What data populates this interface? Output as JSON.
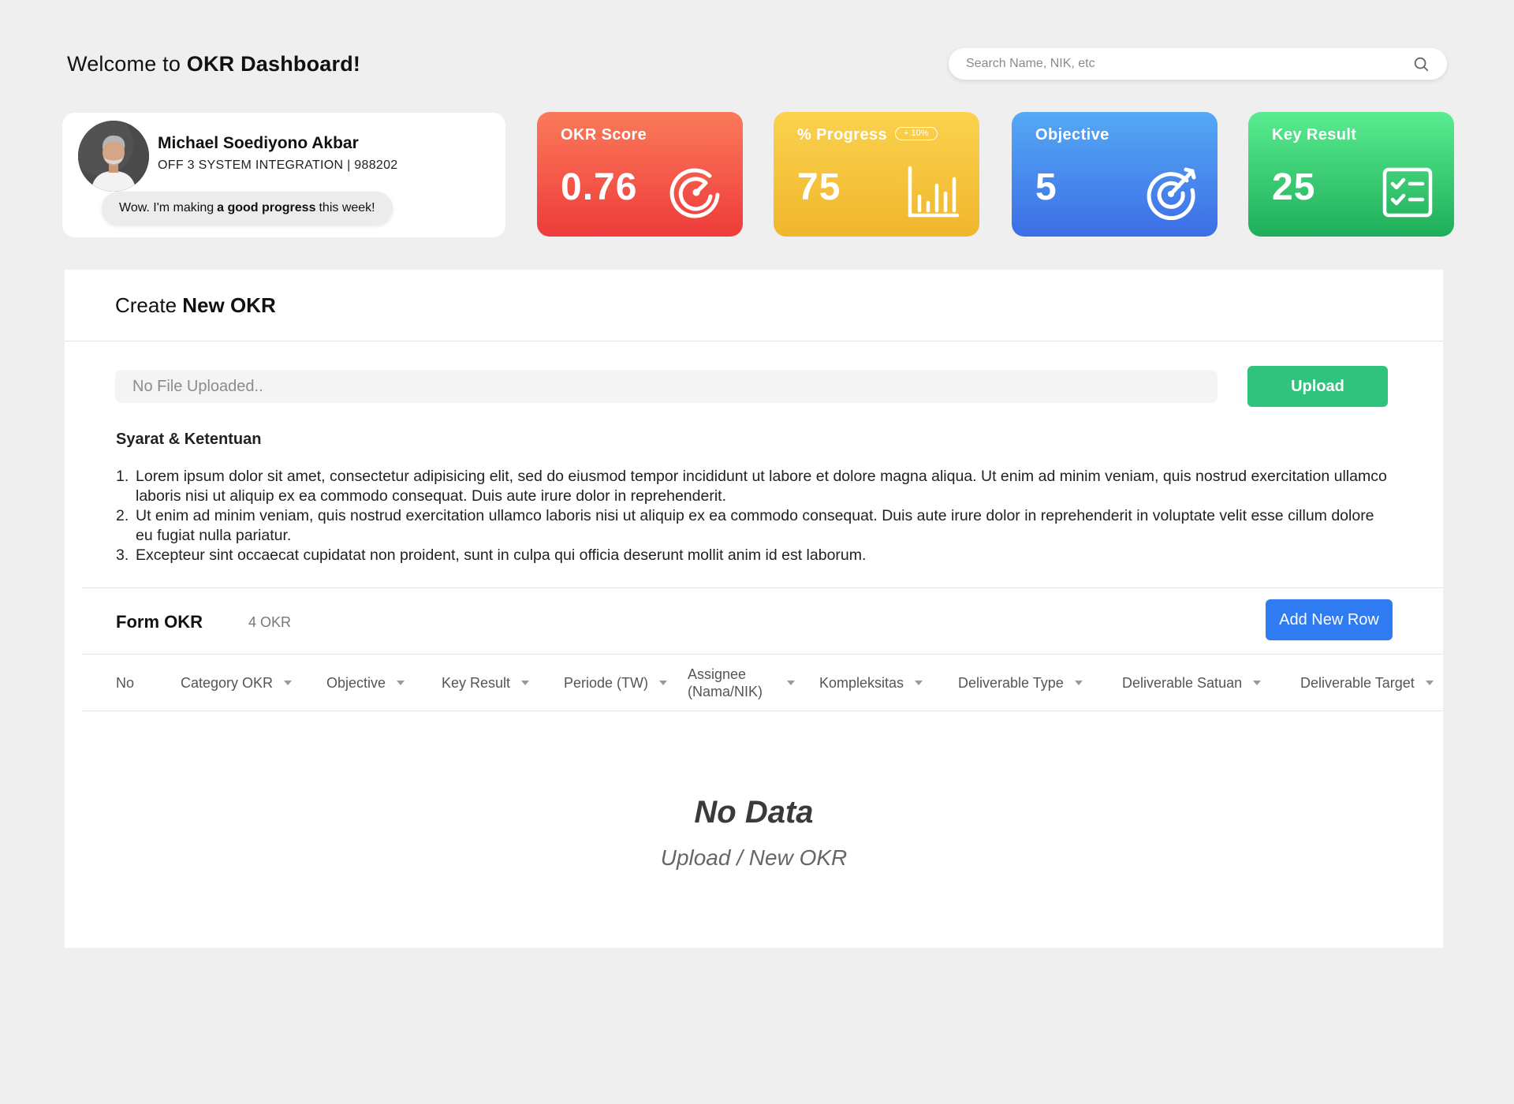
{
  "header": {
    "welcome_prefix": "Welcome to ",
    "welcome_bold": "OKR Dashboard!",
    "search_placeholder": "Search Name, NIK, etc"
  },
  "profile": {
    "name": "Michael Soediyono Akbar",
    "dept": "OFF 3 SYSTEM INTEGRATION | 988202",
    "bubble_prefix": "Wow. I'm making",
    "bubble_bold": "a good progress",
    "bubble_suffix": "this week!"
  },
  "stats": {
    "score": {
      "label": "OKR Score",
      "value": "0.76",
      "color": "#ee3b3b",
      "icon": "speedometer-icon"
    },
    "progress": {
      "label": "% Progress",
      "value": "75",
      "badge": "+ 10%",
      "color": "#f0b62d",
      "icon": "bar-chart-icon"
    },
    "objective": {
      "label": "Objective",
      "value": "5",
      "color": "#3d6ee6",
      "icon": "target-icon"
    },
    "keyresult": {
      "label": "Key Result",
      "value": "25",
      "color": "#1fae5b",
      "icon": "checklist-icon"
    }
  },
  "create": {
    "title_prefix": "Create ",
    "title_bold": "New OKR",
    "file_placeholder": "No File Uploaded..",
    "upload_label": "Upload",
    "terms_title": "Syarat & Ketentuan",
    "terms": [
      {
        "num": "1.",
        "text": "Lorem ipsum dolor sit amet, consectetur adipisicing elit, sed do eiusmod tempor incididunt ut labore et dolore magna aliqua. Ut enim ad minim veniam, quis nostrud exercitation ullamco laboris nisi ut aliquip ex ea commodo consequat. Duis aute irure dolor in reprehenderit."
      },
      {
        "num": "2.",
        "text": "Ut enim ad minim veniam, quis nostrud exercitation ullamco laboris nisi ut aliquip ex ea commodo consequat. Duis aute irure dolor in reprehenderit in voluptate velit esse cillum dolore eu fugiat nulla pariatur."
      },
      {
        "num": "3.",
        "text": "Excepteur sint occaecat cupidatat non proident, sunt in culpa qui officia deserunt mollit anim id est laborum."
      }
    ]
  },
  "form": {
    "title": "Form OKR",
    "count": "4 OKR",
    "add_row_label": "Add New Row",
    "columns": [
      {
        "label": "No",
        "sortable": false
      },
      {
        "label": "Category OKR",
        "sortable": true
      },
      {
        "label": "Objective",
        "sortable": true
      },
      {
        "label": "Key Result",
        "sortable": true
      },
      {
        "label": "Periode (TW)",
        "sortable": true
      },
      {
        "label": "Assignee (Nama/NIK)",
        "sortable": true
      },
      {
        "label": "Kompleksitas",
        "sortable": true
      },
      {
        "label": "Deliverable Type",
        "sortable": true
      },
      {
        "label": "Deliverable Satuan",
        "sortable": true
      },
      {
        "label": "Deliverable Target",
        "sortable": true
      }
    ],
    "empty_title": "No Data",
    "empty_sub": "Upload / New OKR"
  }
}
